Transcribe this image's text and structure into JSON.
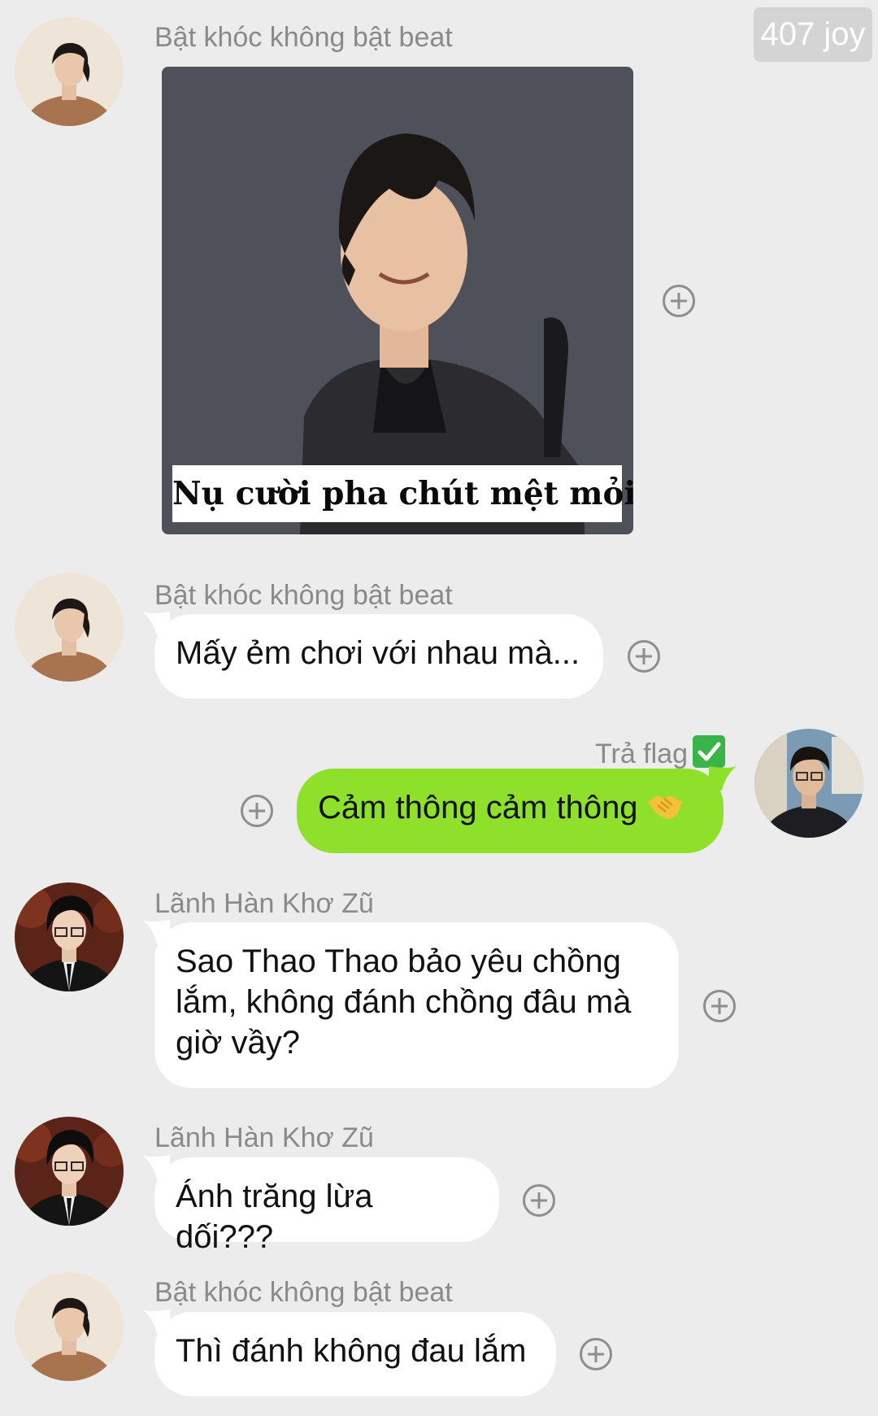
{
  "badge": "407 joy",
  "messages": [
    {
      "sender": "Bật khóc không bật beat",
      "caption": "Nụ cười pha chút mệt mỏi"
    },
    {
      "sender": "Bật khóc không bật beat",
      "text": "Mấy ẻm chơi với nhau mà..."
    },
    {
      "sender": "Trả flag",
      "text": "Cảm thông cảm thông"
    },
    {
      "sender": "Lãnh Hàn Khơ Zũ",
      "lines": [
        "Sao Thao Thao bảo yêu chồng",
        "lắm, không đánh chồng đâu mà",
        "giờ vầy?"
      ]
    },
    {
      "sender": "Lãnh Hàn Khơ Zũ",
      "text": "Ánh trăng lừa dối???"
    },
    {
      "sender": "Bật khóc không bật beat",
      "text": "Thì đánh không đau lắm"
    }
  ],
  "colors": {
    "background": "#ececec",
    "bubble": "#ffffff",
    "self_bubble": "#8ee02a",
    "sender_text": "#8a8a8a"
  },
  "icons": {
    "add_reaction": "plus-circle-icon",
    "verified": "check-mark-button-icon",
    "emoji": "handshake-icon"
  }
}
